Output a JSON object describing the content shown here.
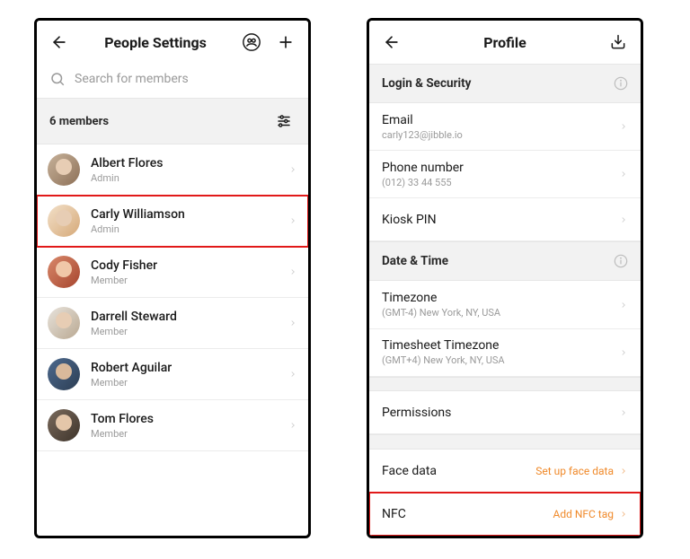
{
  "left": {
    "title": "People Settings",
    "search_placeholder": "Search for members",
    "members_label": "6 members",
    "members": [
      {
        "name": "Albert Flores",
        "role": "Admin",
        "highlight": false
      },
      {
        "name": "Carly Williamson",
        "role": "Admin",
        "highlight": true
      },
      {
        "name": "Cody Fisher",
        "role": "Member",
        "highlight": false
      },
      {
        "name": "Darrell Steward",
        "role": "Member",
        "highlight": false
      },
      {
        "name": "Robert Aguilar",
        "role": "Member",
        "highlight": false
      },
      {
        "name": "Tom Flores",
        "role": "Member",
        "highlight": false
      }
    ]
  },
  "right": {
    "title": "Profile",
    "sections": {
      "login_security": "Login & Security",
      "date_time": "Date & Time"
    },
    "email_label": "Email",
    "email_value": "carly123@jibble.io",
    "phone_label": "Phone number",
    "phone_value": "(012) 33 44 555",
    "kiosk_label": "Kiosk PIN",
    "timezone_label": "Timezone",
    "timezone_value": "(GMT-4) New York, NY, USA",
    "timesheet_tz_label": "Timesheet Timezone",
    "timesheet_tz_value": "(GMT+4) New York, NY, USA",
    "permissions_label": "Permissions",
    "facedata_label": "Face data",
    "facedata_action": "Set up face data",
    "nfc_label": "NFC",
    "nfc_action": "Add NFC tag"
  }
}
